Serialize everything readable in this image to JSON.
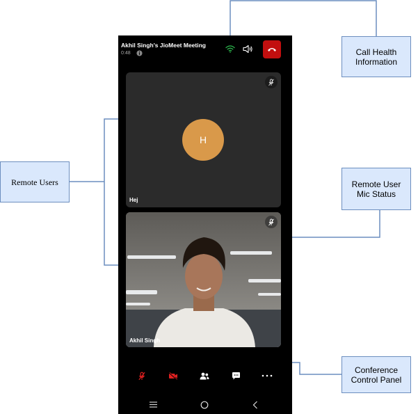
{
  "meeting": {
    "title": "Akhil Singh's JioMeet Meeting",
    "duration": "0:48"
  },
  "participants": [
    {
      "name": "Hej",
      "initial": "H",
      "video": false
    },
    {
      "name": "Akhil Singh",
      "video": true
    }
  ],
  "callouts": {
    "call_health": "Call Health Information",
    "remote_users": "Remote Users",
    "remote_mic": "Remote User Mic Status",
    "control_panel": "Conference Control Panel"
  },
  "colors": {
    "leave_button": "#c20f0f",
    "avatar": "#d9994a",
    "callout_fill": "#dae8fc",
    "callout_border": "#6c8ebf",
    "muted_control": "#e02020"
  },
  "icons": {
    "network": "wifi-icon",
    "speaker": "speaker-icon",
    "leave": "phone-hangup-icon",
    "mic_status": "mic-muted-icon",
    "controls": [
      "mic-muted-icon",
      "video-off-icon",
      "participants-icon",
      "chat-icon",
      "more-icon"
    ],
    "nav": [
      "menu-icon",
      "home-icon",
      "back-icon"
    ]
  }
}
